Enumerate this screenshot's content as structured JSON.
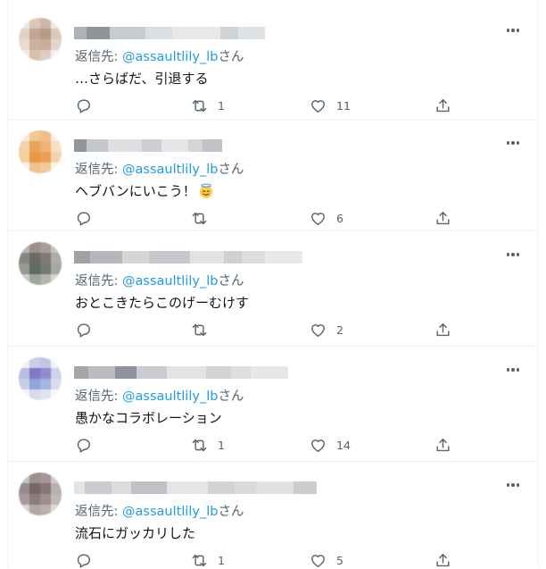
{
  "colors": {
    "text": "#0f1419",
    "secondary": "#536471",
    "link": "#1d9bf0",
    "border": "#eff3f4"
  },
  "icons": {
    "reply": "reply-icon",
    "retweet": "retweet-icon",
    "like": "heart-icon",
    "share": "share-icon",
    "more": "more-icon"
  },
  "tweets": [
    {
      "reply_prefix": "返信先: ",
      "reply_handle": "@assaultlily_lb",
      "reply_suffix": "さん",
      "text": "…さらばだ、引退する",
      "emoji": "",
      "retweets": "1",
      "likes": "11"
    },
    {
      "reply_prefix": "返信先: ",
      "reply_handle": "@assaultlily_lb",
      "reply_suffix": "さん",
      "text": "ヘブバンにいこう！",
      "emoji": "smiling-face-with-halo",
      "retweets": "",
      "likes": "6"
    },
    {
      "reply_prefix": "返信先: ",
      "reply_handle": "@assaultlily_lb",
      "reply_suffix": "さん",
      "text": "おとこきたらこのげーむけす",
      "emoji": "",
      "retweets": "",
      "likes": "2"
    },
    {
      "reply_prefix": "返信先: ",
      "reply_handle": "@assaultlily_lb",
      "reply_suffix": "さん",
      "text": "愚かなコラボレーション",
      "emoji": "",
      "retweets": "1",
      "likes": "14"
    },
    {
      "reply_prefix": "返信先: ",
      "reply_handle": "@assaultlily_lb",
      "reply_suffix": "さん",
      "text": "流石にガッカリした",
      "emoji": "",
      "retweets": "1",
      "likes": "5"
    }
  ]
}
